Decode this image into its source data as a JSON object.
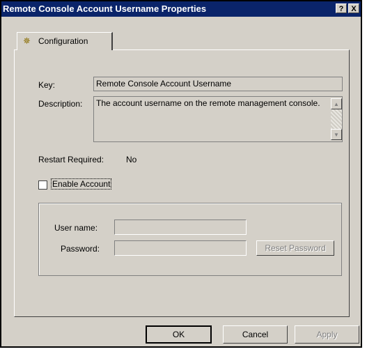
{
  "window": {
    "title": "Remote Console Account Username Properties",
    "help_button": "?",
    "close_button": "X"
  },
  "tabs": [
    {
      "label": "Configuration",
      "icon": "gear-icon",
      "selected": true
    }
  ],
  "config": {
    "key_label": "Key:",
    "key_value": "Remote Console Account Username",
    "description_label": "Description:",
    "description_value": "The account username on the remote management console.",
    "restart_label": "Restart Required:",
    "restart_value": "No",
    "enable_account_label": "Enable Account",
    "enable_account_checked": false
  },
  "account_group": {
    "username_label": "User name:",
    "username_value": "",
    "password_label": "Password:",
    "password_value": "",
    "reset_password_label": "Reset Password"
  },
  "footer": {
    "ok_label": "OK",
    "cancel_label": "Cancel",
    "apply_label": "Apply"
  }
}
